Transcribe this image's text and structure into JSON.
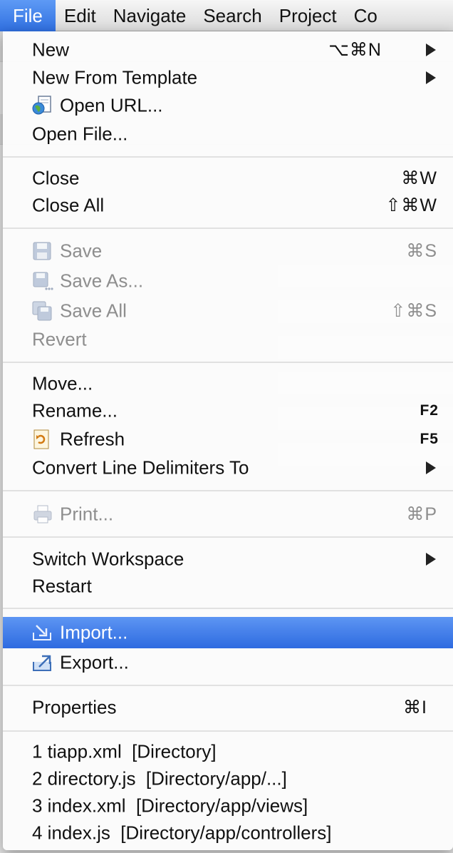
{
  "menubar": {
    "items": [
      {
        "label": "File"
      },
      {
        "label": "Edit"
      },
      {
        "label": "Navigate"
      },
      {
        "label": "Search"
      },
      {
        "label": "Project"
      },
      {
        "label": "Co"
      }
    ]
  },
  "menu": {
    "new": {
      "label": "New",
      "shortcut": "⌥⌘N"
    },
    "new_from_template": {
      "label": "New From Template"
    },
    "open_url": {
      "label": "Open URL...",
      "icon": "globe-document-icon"
    },
    "open_file": {
      "label": "Open File..."
    },
    "close": {
      "label": "Close",
      "shortcut": "⌘W"
    },
    "close_all": {
      "label": "Close All",
      "shortcut": "⇧⌘W"
    },
    "save": {
      "label": "Save",
      "shortcut": "⌘S",
      "icon": "floppy-disk-icon"
    },
    "save_as": {
      "label": "Save As...",
      "icon": "floppy-disk-dots-icon"
    },
    "save_all": {
      "label": "Save All",
      "shortcut": "⇧⌘S",
      "icon": "floppy-disks-icon"
    },
    "revert": {
      "label": "Revert"
    },
    "move": {
      "label": "Move..."
    },
    "rename": {
      "label": "Rename...",
      "shortcut": "F2"
    },
    "refresh": {
      "label": "Refresh",
      "shortcut": "F5",
      "icon": "refresh-icon"
    },
    "convert": {
      "label": "Convert Line Delimiters To"
    },
    "print": {
      "label": "Print...",
      "shortcut": "⌘P",
      "icon": "printer-icon"
    },
    "switch_workspace": {
      "label": "Switch Workspace"
    },
    "restart": {
      "label": "Restart"
    },
    "import": {
      "label": "Import...",
      "icon": "import-icon"
    },
    "export": {
      "label": "Export...",
      "icon": "export-icon"
    },
    "properties": {
      "label": "Properties",
      "shortcut": "⌘I"
    },
    "recent": [
      {
        "label": "1 tiapp.xml  [Directory]"
      },
      {
        "label": "2 directory.js  [Directory/app/...]"
      },
      {
        "label": "3 index.xml  [Directory/app/views]"
      },
      {
        "label": "4 index.js  [Directory/app/controllers]"
      }
    ]
  },
  "colors": {
    "selection": "#3a78e6",
    "disabled_text": "#8e8e8e"
  }
}
